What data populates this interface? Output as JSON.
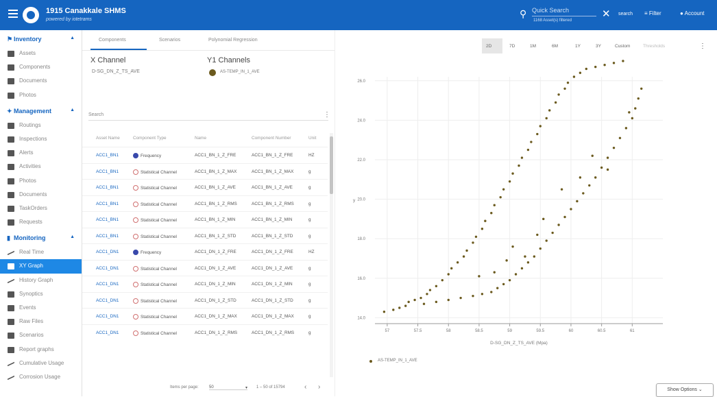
{
  "header": {
    "title": "1915 Canakkale SHMS",
    "subtitle": "powered by iotetrams",
    "search_placeholder": "Quick Search",
    "assets_count": "1168 Asset(s) filtered",
    "search_label": "search",
    "filter_label": "Filter",
    "account_label": "Account",
    "brand_color": "#1565c0"
  },
  "sidebar": {
    "sections": [
      {
        "label": "Inventory",
        "icon": "bookmark-icon",
        "items": [
          {
            "label": "Assets",
            "icon": "assets-icon"
          },
          {
            "label": "Components",
            "icon": "gear-icon"
          },
          {
            "label": "Documents",
            "icon": "document-icon"
          },
          {
            "label": "Photos",
            "icon": "photo-icon"
          }
        ]
      },
      {
        "label": "Management",
        "icon": "pin-icon",
        "items": [
          {
            "label": "Routings",
            "icon": "route-icon"
          },
          {
            "label": "Inspections",
            "icon": "list-icon"
          },
          {
            "label": "Alerts",
            "icon": "flag-icon"
          },
          {
            "label": "Activities",
            "icon": "wrench-icon"
          },
          {
            "label": "Photos",
            "icon": "photo-icon"
          },
          {
            "label": "Documents",
            "icon": "document-icon"
          },
          {
            "label": "TaskOrders",
            "icon": "briefcase-icon"
          },
          {
            "label": "Requests",
            "icon": "request-icon"
          }
        ]
      },
      {
        "label": "Monitoring",
        "icon": "chart-icon",
        "items": [
          {
            "label": "Real Time",
            "icon": "trend-icon"
          },
          {
            "label": "XY Graph",
            "icon": "scatter-icon",
            "active": true
          },
          {
            "label": "History Graph",
            "icon": "trend-icon"
          },
          {
            "label": "Synoptics",
            "icon": "synoptic-icon"
          },
          {
            "label": "Events",
            "icon": "event-icon"
          },
          {
            "label": "Raw Files",
            "icon": "event-icon"
          },
          {
            "label": "Scenarios",
            "icon": "file-icon"
          },
          {
            "label": "Report graphs",
            "icon": "report-icon"
          },
          {
            "label": "Cumulative Usage",
            "icon": "trend-icon"
          },
          {
            "label": "Corrosion Usage",
            "icon": "trend-icon"
          }
        ]
      }
    ]
  },
  "tabs": [
    "Components",
    "Scenarios",
    "Polynomial Regression"
  ],
  "channels": {
    "x_title": "X Channel",
    "x_value": "D-SG_DN_Z_TS_AVE",
    "y_title": "Y1 Channels",
    "y_value": "AS-TEMP_IN_1_AVE",
    "y_color": "#6b5a1e"
  },
  "table": {
    "search_label": "Search",
    "columns": [
      "Asset Name",
      "Component Type",
      "Name",
      "Component Number",
      "Unit"
    ],
    "rows": [
      [
        "ACC1_BN1",
        "Frequency",
        "ACC1_BN_1_Z_FRE",
        "ACC1_BN_1_Z_FRE",
        "HZ",
        "freq"
      ],
      [
        "ACC1_BN1",
        "Statistical Channel",
        "ACC1_BN_1_Z_MAX",
        "ACC1_BN_1_Z_MAX",
        "g",
        "stat"
      ],
      [
        "ACC1_BN1",
        "Statistical Channel",
        "ACC1_BN_1_Z_AVE",
        "ACC1_BN_1_Z_AVE",
        "g",
        "stat"
      ],
      [
        "ACC1_BN1",
        "Statistical Channel",
        "ACC1_BN_1_Z_RMS",
        "ACC1_BN_1_Z_RMS",
        "g",
        "stat"
      ],
      [
        "ACC1_BN1",
        "Statistical Channel",
        "ACC1_BN_1_Z_MIN",
        "ACC1_BN_1_Z_MIN",
        "g",
        "stat"
      ],
      [
        "ACC1_BN1",
        "Statistical Channel",
        "ACC1_BN_1_Z_STD",
        "ACC1_BN_1_Z_STD",
        "g",
        "stat"
      ],
      [
        "ACC1_DN1",
        "Frequency",
        "ACC1_DN_1_Z_FRE",
        "ACC1_DN_1_Z_FRE",
        "HZ",
        "freq"
      ],
      [
        "ACC1_DN1",
        "Statistical Channel",
        "ACC1_DN_1_Z_AVE",
        "ACC1_DN_1_Z_AVE",
        "g",
        "stat"
      ],
      [
        "ACC1_DN1",
        "Statistical Channel",
        "ACC1_DN_1_Z_MIN",
        "ACC1_DN_1_Z_MIN",
        "g",
        "stat"
      ],
      [
        "ACC1_DN1",
        "Statistical Channel",
        "ACC1_DN_1_Z_STD",
        "ACC1_DN_1_Z_STD",
        "g",
        "stat"
      ],
      [
        "ACC1_DN1",
        "Statistical Channel",
        "ACC1_DN_1_Z_MAX",
        "ACC1_DN_1_Z_MAX",
        "g",
        "stat"
      ],
      [
        "ACC1_DN1",
        "Statistical Channel",
        "ACC1_DN_1_Z_RMS",
        "ACC1_DN_1_Z_RMS",
        "g",
        "stat"
      ]
    ],
    "items_per_page_label": "Items per page:",
    "items_per_page": "50",
    "range": "1 – 50 of 15794"
  },
  "time_ranges": [
    "2D",
    "7D",
    "1M",
    "6M",
    "1Y",
    "3Y",
    "Custom",
    "Thresholds"
  ],
  "active_range": "2D",
  "show_options": "Show Options",
  "chart_data": {
    "type": "scatter",
    "xlabel": "D-SG_DN_Z_TS_AVE (Mpa)",
    "ylabel": "y",
    "xlim": [
      56.8,
      61.5
    ],
    "ylim": [
      13.7,
      26.2
    ],
    "x_ticks": [
      57,
      57.5,
      58,
      58.5,
      59,
      59.5,
      60,
      60.5,
      61
    ],
    "y_ticks": [
      14,
      16,
      18,
      20,
      22,
      24,
      26
    ],
    "y_tick_labels": [
      "14.0",
      "16.0",
      "18.0",
      "20.0",
      "22.0",
      "24.0",
      "26.0"
    ],
    "grid": true,
    "legend": "bottom-left",
    "series": [
      {
        "name": "AS-TEMP_IN_1_AVE",
        "color": "#6b5a1e",
        "points": [
          [
            56.95,
            14.3
          ],
          [
            57.1,
            14.4
          ],
          [
            57.2,
            14.5
          ],
          [
            57.3,
            14.6
          ],
          [
            57.35,
            14.8
          ],
          [
            57.45,
            14.9
          ],
          [
            57.55,
            15.0
          ],
          [
            57.65,
            15.2
          ],
          [
            57.7,
            15.4
          ],
          [
            57.8,
            15.6
          ],
          [
            57.9,
            15.9
          ],
          [
            58.0,
            16.2
          ],
          [
            58.05,
            16.5
          ],
          [
            58.15,
            16.8
          ],
          [
            58.25,
            17.1
          ],
          [
            58.3,
            17.4
          ],
          [
            58.4,
            17.8
          ],
          [
            58.45,
            18.1
          ],
          [
            58.55,
            18.5
          ],
          [
            58.6,
            18.9
          ],
          [
            58.7,
            19.3
          ],
          [
            58.75,
            19.7
          ],
          [
            58.85,
            20.1
          ],
          [
            58.9,
            20.5
          ],
          [
            59.0,
            20.9
          ],
          [
            59.05,
            21.3
          ],
          [
            59.15,
            21.7
          ],
          [
            59.2,
            22.1
          ],
          [
            59.3,
            22.5
          ],
          [
            59.35,
            22.9
          ],
          [
            59.45,
            23.3
          ],
          [
            59.5,
            23.7
          ],
          [
            59.6,
            24.1
          ],
          [
            59.65,
            24.5
          ],
          [
            59.75,
            24.9
          ],
          [
            59.8,
            25.3
          ],
          [
            59.9,
            25.6
          ],
          [
            59.95,
            25.9
          ],
          [
            60.05,
            26.2
          ],
          [
            60.15,
            26.4
          ],
          [
            60.25,
            26.6
          ],
          [
            60.4,
            26.7
          ],
          [
            60.55,
            26.8
          ],
          [
            60.7,
            26.9
          ],
          [
            60.85,
            27.0
          ],
          [
            57.6,
            14.7
          ],
          [
            57.8,
            14.8
          ],
          [
            58.0,
            14.9
          ],
          [
            58.2,
            15.0
          ],
          [
            58.4,
            15.1
          ],
          [
            58.55,
            15.2
          ],
          [
            58.7,
            15.3
          ],
          [
            58.8,
            15.5
          ],
          [
            58.9,
            15.7
          ],
          [
            59.0,
            15.9
          ],
          [
            59.1,
            16.2
          ],
          [
            59.2,
            16.5
          ],
          [
            59.3,
            16.8
          ],
          [
            59.4,
            17.1
          ],
          [
            59.5,
            17.5
          ],
          [
            59.6,
            17.9
          ],
          [
            59.7,
            18.3
          ],
          [
            59.8,
            18.7
          ],
          [
            59.9,
            19.1
          ],
          [
            60.0,
            19.5
          ],
          [
            60.1,
            19.9
          ],
          [
            60.2,
            20.3
          ],
          [
            60.3,
            20.7
          ],
          [
            60.4,
            21.1
          ],
          [
            60.5,
            21.6
          ],
          [
            60.6,
            22.1
          ],
          [
            60.7,
            22.6
          ],
          [
            60.8,
            23.1
          ],
          [
            60.9,
            23.6
          ],
          [
            61.0,
            24.1
          ],
          [
            61.05,
            24.6
          ],
          [
            61.1,
            25.1
          ],
          [
            61.15,
            25.6
          ],
          [
            60.95,
            24.4
          ],
          [
            60.6,
            21.5
          ],
          [
            59.45,
            18.2
          ],
          [
            59.25,
            17.1
          ],
          [
            58.95,
            16.9
          ],
          [
            58.75,
            16.3
          ],
          [
            59.55,
            19.0
          ],
          [
            59.85,
            20.5
          ],
          [
            60.15,
            21.1
          ],
          [
            59.05,
            17.6
          ],
          [
            58.5,
            16.1
          ],
          [
            60.35,
            22.2
          ]
        ]
      }
    ]
  }
}
